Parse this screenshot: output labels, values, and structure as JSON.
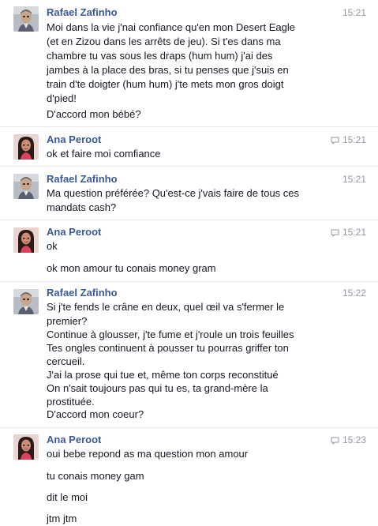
{
  "conversation": [
    {
      "sender": "Rafael Zafinho",
      "time": "15:21",
      "seen_icon": false,
      "avatar": "man-avatar",
      "lines": [
        "Moi dans la vie j'nai confiance qu'en mon Desert Eagle",
        "(et en Zizou dans les arrêts de jeu). Si t'es dans ma",
        "chambre tu vas sous les draps (hum hum) j'ai des",
        "jambes à la place des bras, si tu penses que j'suis en",
        "train d'te doigter (hum hum) j'te mets mon gros doigt",
        "d'pied!",
        "",
        "D'accord mon bébé?"
      ]
    },
    {
      "sender": "Ana Peroot",
      "time": "15:21",
      "seen_icon": true,
      "avatar": "woman-avatar",
      "lines": [
        "ok et faire moi comfiance"
      ]
    },
    {
      "sender": "Rafael Zafinho",
      "time": "15:21",
      "seen_icon": false,
      "avatar": "man-avatar",
      "lines": [
        "Ma question préférée? Qu'est-ce j'vais faire de tous ces",
        "mandats cash?"
      ]
    },
    {
      "sender": "Ana Peroot",
      "time": "15:21",
      "seen_icon": true,
      "avatar": "woman-avatar",
      "lines": [
        "ok",
        "",
        "ok mon amour tu conais money gram"
      ]
    },
    {
      "sender": "Rafael Zafinho",
      "time": "15:22",
      "seen_icon": false,
      "avatar": "man-avatar",
      "lines": [
        "Si j'te fends le crâne en deux, quel œil va s'fermer le",
        "premier?",
        "Continue à glousser, j'te fume et j'roule un trois feuilles",
        "Tes ongles continuent à pousser tu pourras griffer ton",
        "cercueil.",
        "J'ai la prose qui tue et, même ton corps reconstitué",
        "On n'sait toujours pas qui tu es, ta grand-mère la",
        "prostituée.",
        "D'accord mon coeur?"
      ]
    },
    {
      "sender": "Ana Peroot",
      "time": "15:23",
      "seen_icon": true,
      "avatar": "woman-avatar",
      "lines": [
        "oui bebe repond as ma question mon amour",
        "",
        "tu conais money gam",
        "",
        "dit le moi",
        "",
        "jtm jtm"
      ]
    }
  ]
}
